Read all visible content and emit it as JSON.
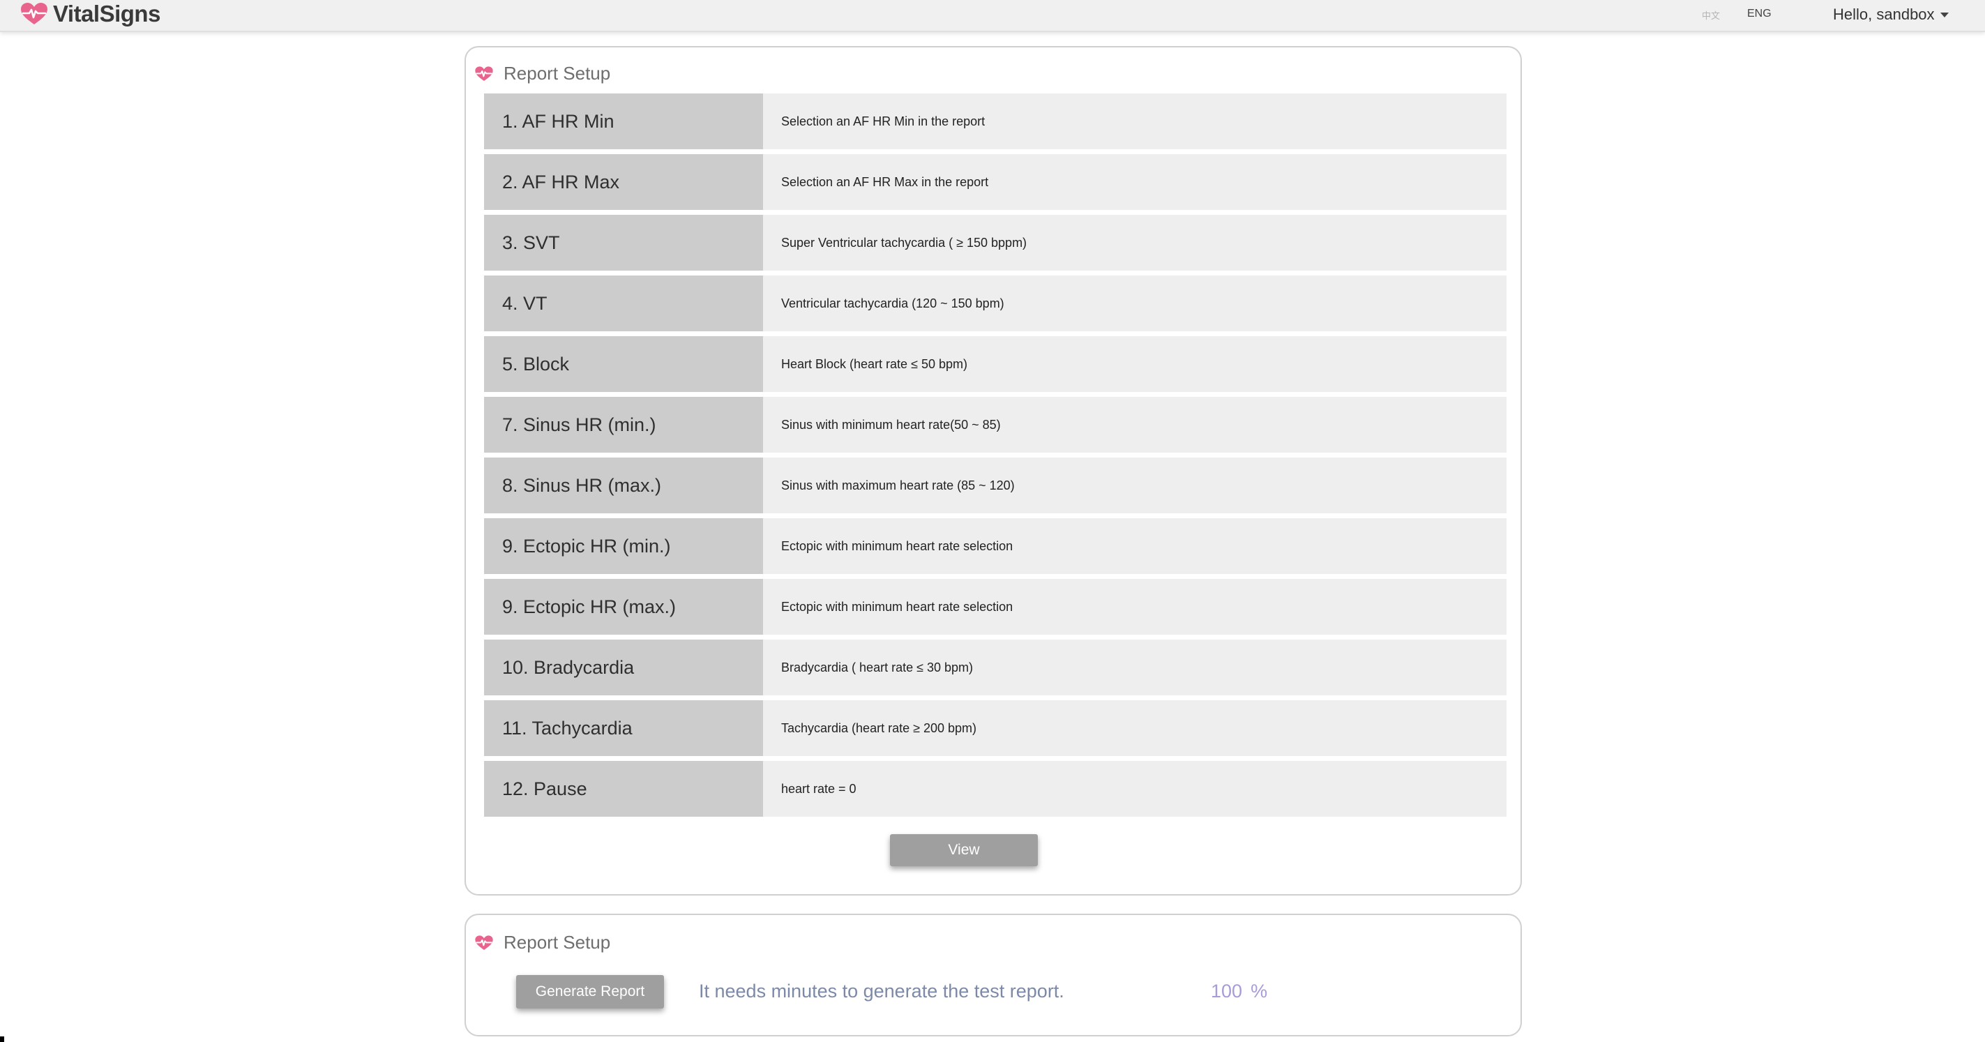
{
  "app": {
    "brand": "VitalSigns",
    "brand_icon": "heart-pulse-icon",
    "accent_color": "#e8648c"
  },
  "nav": {
    "lang_zh": "中文",
    "lang_en": "ENG",
    "user_greeting": "Hello, sandbox"
  },
  "setup_panel": {
    "title": "Report Setup",
    "icon": "heart-pulse-icon",
    "items": [
      {
        "label": "1. AF HR Min",
        "description": "Selection an AF HR Min in the report"
      },
      {
        "label": "2. AF HR Max",
        "description": "Selection an AF HR Max in the report"
      },
      {
        "label": "3. SVT",
        "description": "Super Ventricular tachycardia ( ≥ 150 bppm)"
      },
      {
        "label": "4. VT",
        "description": "Ventricular tachycardia (120 ~ 150 bpm)"
      },
      {
        "label": "5. Block",
        "description": "Heart Block (heart rate ≤ 50 bpm)"
      },
      {
        "label": "7. Sinus HR (min.)",
        "description": "Sinus with minimum heart rate(50 ~ 85)"
      },
      {
        "label": "8. Sinus HR (max.)",
        "description": "Sinus with maximum heart rate (85 ~ 120)"
      },
      {
        "label": "9. Ectopic HR (min.)",
        "description": "Ectopic with minimum heart rate selection"
      },
      {
        "label": "9. Ectopic HR (max.)",
        "description": "Ectopic with minimum heart rate selection"
      },
      {
        "label": "10. Bradycardia",
        "description": "Bradycardia ( heart rate ≤ 30 bpm)"
      },
      {
        "label": "11. Tachycardia",
        "description": "Tachycardia (heart rate ≥ 200 bpm)"
      },
      {
        "label": "12. Pause",
        "description": "heart rate = 0"
      }
    ],
    "view_button": "View"
  },
  "generate_panel": {
    "title": "Report Setup",
    "icon": "heart-pulse-icon",
    "generate_button": "Generate Report",
    "message": "It needs minutes to generate the test report.",
    "progress_value": "100",
    "progress_unit": "%"
  }
}
